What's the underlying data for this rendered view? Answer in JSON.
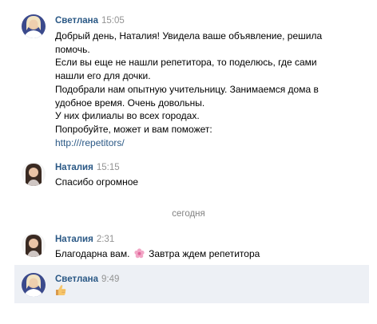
{
  "messages": [
    {
      "author": "Светлана",
      "time": "15:05",
      "lines": [
        "Добрый день, Наталия! Увидела ваше объявление, решила",
        "помочь.",
        "Если вы еще не нашли репетитора, то поделюсь, где сами",
        "нашли его для дочки.",
        "Подобрали нам опытную учительницу. Занимаемся дома в",
        "удобное время. Очень довольны.",
        "У них филиалы во всех городах.",
        "Попробуйте, может и вам поможет:"
      ],
      "link_start": "http://",
      "link_end": "/repetitors/"
    },
    {
      "author": "Наталия",
      "time": "15:15",
      "text": "Спасибо огромное"
    },
    {
      "author": "Наталия",
      "time": "2:31",
      "text_before": "Благодарна вам.",
      "emoji": "flower-emoji",
      "text_after": "Завтра ждем репетитора"
    },
    {
      "author": "Светлана",
      "time": "9:49",
      "emoji": "thumbs-up-emoji"
    }
  ],
  "date_divider": "сегодня",
  "colors": {
    "author": "#2a5885",
    "time": "#939393",
    "highlight": "#edf0f5"
  }
}
